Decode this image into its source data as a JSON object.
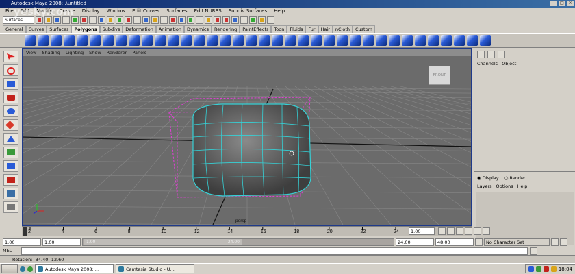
{
  "window": {
    "title": "Autodesk Maya 2008: .\\untitled",
    "controls": [
      "_",
      "□",
      "×"
    ]
  },
  "menubar": [
    "File",
    "Edit",
    "Modify",
    "Create",
    "Display",
    "Window",
    "Edit Curves",
    "Surfaces",
    "Edit NURBS",
    "Subdiv Surfaces",
    "Help"
  ],
  "status_line": {
    "mode_selector": "Surfaces"
  },
  "watermark": "yesky.com",
  "shelf_tabs": [
    "General",
    "Curves",
    "Surfaces",
    "Polygons",
    "Subdivs",
    "Deformation",
    "Animation",
    "Dynamics",
    "Rendering",
    "PaintEffects",
    "Toon",
    "Fluids",
    "Fur",
    "Hair",
    "nCloth",
    "Custom"
  ],
  "active_shelf_tab": "Polygons",
  "shelf_icon_colors": [
    "#2a5bd6",
    "#2a5bd6",
    "#2a5bd6",
    "#2a5bd6",
    "#2a5bd6",
    "#2a5bd6",
    "#2a5bd6",
    "#2a5bd6",
    "#2a5bd6",
    "#2a5bd6",
    "#2a5bd6",
    "#2a5bd6",
    "#2a5bd6",
    "#2a5bd6",
    "#2a5bd6",
    "#2a5bd6",
    "#2a5bd6",
    "#2a5bd6",
    "#2a5bd6",
    "#2a5bd6",
    "#2a5bd6",
    "#2a5bd6",
    "#2a5bd6",
    "#2a5bd6",
    "#2a5bd6",
    "#2a5bd6",
    "#2a5bd6",
    "#2a5bd6",
    "#2a5bd6",
    "#2a5bd6",
    "#2a5bd6",
    "#2a5bd6",
    "#2a5bd6",
    "#2a5bd6",
    "#2a5bd6",
    "#2a5bd6"
  ],
  "tools": [
    "select-tool-icon",
    "lasso-tool-icon",
    "paint-select-tool-icon",
    "move-tool-icon",
    "rotate-tool-icon",
    "scale-tool-icon",
    "soft-mod-tool-icon",
    "show-manipulator-icon",
    "last-tool-icon",
    "layout-single-icon",
    "layout-four-icon",
    "layout-persp-outliner-icon"
  ],
  "viewport": {
    "menu": [
      "View",
      "Shading",
      "Lighting",
      "Show",
      "Renderer",
      "Panels"
    ],
    "camera_label": "persp",
    "view_cube": "FRONT",
    "background": "#6b6b6b",
    "grid_color": "#888888",
    "object_color": "#6e6e6e",
    "wire_color": "#36d1d6",
    "bbox_color": "#e23fd6"
  },
  "channel_box": {
    "tabs": [
      "Channels",
      "Object"
    ],
    "display_options": [
      "Display",
      "Render"
    ],
    "layer_menu": [
      "Layers",
      "Options",
      "Help"
    ]
  },
  "timeline": {
    "ticks": [
      "2",
      "4",
      "6",
      "8",
      "10",
      "12",
      "14",
      "16",
      "18",
      "20",
      "22",
      "24"
    ],
    "current_frame": "1.00"
  },
  "range": {
    "start": "1.00",
    "playback_start": "1.00",
    "start_knob": "1.00",
    "end_knob": "24.00",
    "playback_end": "24.00",
    "end": "48.00",
    "character_set": "No Character Set"
  },
  "command_line": {
    "label": "MEL"
  },
  "help_line": "Rotation: -34.40  -12.60",
  "taskbar": {
    "items": [
      "Autodesk Maya 2008: ...",
      "Camtasia Studio - U..."
    ],
    "clock": "18:04"
  }
}
